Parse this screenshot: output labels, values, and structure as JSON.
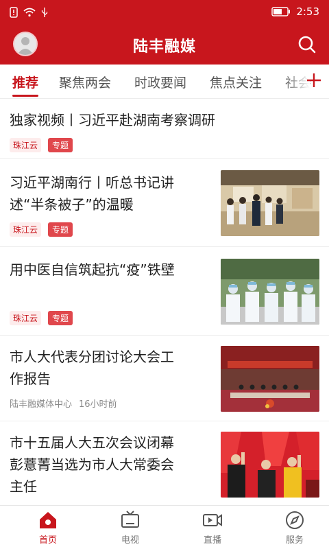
{
  "status": {
    "time": "2:53"
  },
  "header": {
    "title": "陆丰融媒"
  },
  "tabs": [
    "推荐",
    "聚焦两会",
    "时政要闻",
    "焦点关注",
    "社会"
  ],
  "feed": [
    {
      "title": "独家视频丨习近平赴湖南考察调研",
      "source": "珠江云",
      "tag": "专题"
    },
    {
      "title_lines": [
        "习近平湖南行丨听总书记讲",
        "述“半条被子”的温暖"
      ],
      "source": "珠江云",
      "tag": "专题"
    },
    {
      "title": "用中医自信筑起抗“疫”铁壁",
      "source": "珠江云",
      "tag": "专题"
    },
    {
      "title_lines": [
        "市人大代表分团讨论大会工",
        "作报告"
      ],
      "source": "陆丰融媒体中心",
      "time": "16小时前"
    },
    {
      "title_lines": [
        "市十五届人大五次会议闭幕",
        "彭薏菁当选为市人大常委会",
        "主任"
      ]
    }
  ],
  "bottom_nav": [
    {
      "label": "首页",
      "icon": "home-icon"
    },
    {
      "label": "电视",
      "icon": "tv-icon"
    },
    {
      "label": "直播",
      "icon": "live-video-icon"
    },
    {
      "label": "服务",
      "icon": "compass-icon"
    }
  ],
  "colors": {
    "brand": "#c8161d",
    "tag_bg": "#fdecec",
    "tag_topic": "#e0474c"
  }
}
